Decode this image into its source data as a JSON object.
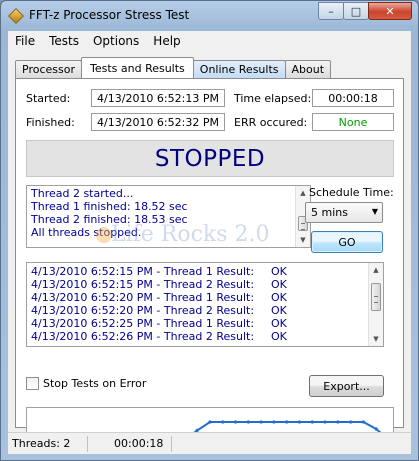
{
  "window": {
    "title": "FFT-z Processor Stress Test"
  },
  "menu": [
    "File",
    "Tests",
    "Options",
    "Help"
  ],
  "tabs": [
    "Processor",
    "Tests and Results",
    "Online Results",
    "About"
  ],
  "fields": {
    "started_label": "Started:",
    "started_value": "4/13/2010 6:52:13 PM",
    "finished_label": "Finished:",
    "finished_value": "4/13/2010 6:52:32 PM",
    "elapsed_label": "Time elapsed:",
    "elapsed_value": "00:00:18",
    "err_label": "ERR occured:",
    "err_value": "None"
  },
  "status": "STOPPED",
  "log": [
    "Thread 2 started...",
    "Thread 1 finished: 18.52 sec",
    "Thread 2 finished: 18.53 sec",
    "All threads stopped."
  ],
  "schedule": {
    "label": "Schedule Time:",
    "value": "5 mins",
    "go_label": "GO"
  },
  "watermark": "Life Rocks 2.0",
  "results": [
    {
      "time": "4/13/2010 6:52:15 PM - Thread 1 Result:",
      "status": "OK"
    },
    {
      "time": "4/13/2010 6:52:15 PM - Thread 2 Result:",
      "status": "OK"
    },
    {
      "time": "4/13/2010 6:52:20 PM - Thread 1 Result:",
      "status": "OK"
    },
    {
      "time": "4/13/2010 6:52:20 PM - Thread 2 Result:",
      "status": "OK"
    },
    {
      "time": "4/13/2010 6:52:25 PM - Thread 1 Result:",
      "status": "OK"
    },
    {
      "time": "4/13/2010 6:52:26 PM - Thread 2 Result:",
      "status": "OK"
    }
  ],
  "controls": {
    "stop_on_error": "Stop Tests on Error",
    "export": "Export..."
  },
  "graph": {
    "line_color": "#1f6fd0",
    "values": [
      0.1,
      0.1,
      0.1,
      0.1,
      0.1,
      0.1,
      0.1,
      0.1,
      0.1,
      0.1,
      0.1,
      0.1,
      0.1,
      0.45,
      0.75,
      0.75,
      0.75,
      0.75,
      0.75,
      0.75,
      0.75,
      0.75,
      0.75,
      0.75,
      0.75,
      0.75,
      0.75,
      0.5,
      0.1
    ]
  },
  "statusbar": {
    "threads": "Threads: 2",
    "time": "00:00:18"
  },
  "colors": {
    "err_ok": "#00a000",
    "status_text": "#000080",
    "log_text": "#000090"
  }
}
